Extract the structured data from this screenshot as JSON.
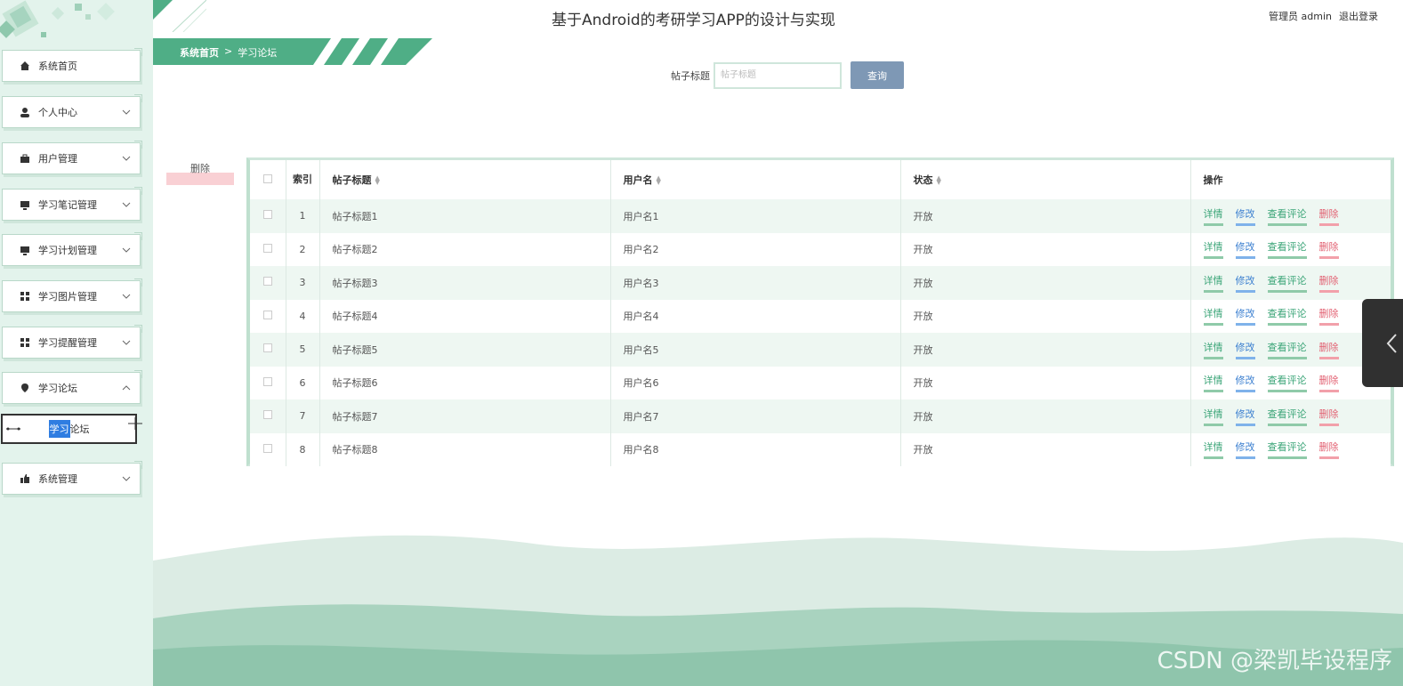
{
  "app": {
    "title": "基于Android的考研学习APP的设计与实现",
    "user_label": "管理员 admin",
    "logout_label": "退出登录"
  },
  "breadcrumb": {
    "home": "系统首页",
    "separator": ">",
    "current": "学习论坛"
  },
  "sidebar": {
    "items": [
      {
        "label": "系统首页",
        "icon": "home-icon",
        "expandable": false
      },
      {
        "label": "个人中心",
        "icon": "user-icon",
        "expandable": true
      },
      {
        "label": "用户管理",
        "icon": "briefcase-icon",
        "expandable": true
      },
      {
        "label": "学习笔记管理",
        "icon": "monitor-icon",
        "expandable": true
      },
      {
        "label": "学习计划管理",
        "icon": "monitor-icon",
        "expandable": true
      },
      {
        "label": "学习图片管理",
        "icon": "grid-icon",
        "expandable": true
      },
      {
        "label": "学习提醒管理",
        "icon": "grid-icon",
        "expandable": true
      },
      {
        "label": "学习论坛",
        "icon": "location-pin-icon",
        "expandable": true,
        "expanded": true
      },
      {
        "label": "系统管理",
        "icon": "thumbs-up-icon",
        "expandable": true
      }
    ],
    "subitem": {
      "selected_part": "学习",
      "rest_part": "论坛"
    }
  },
  "search": {
    "label": "帖子标题",
    "placeholder": "帖子标题",
    "button": "查询"
  },
  "batch_delete_label": "删除",
  "table": {
    "headers": {
      "index": "索引",
      "title": "帖子标题",
      "username": "用户名",
      "status": "状态",
      "actions": "操作"
    },
    "action_labels": {
      "detail": "详情",
      "edit": "修改",
      "comments": "查看评论",
      "delete": "删除"
    },
    "rows": [
      {
        "index": "1",
        "title": "帖子标题1",
        "username": "用户名1",
        "status": "开放"
      },
      {
        "index": "2",
        "title": "帖子标题2",
        "username": "用户名2",
        "status": "开放"
      },
      {
        "index": "3",
        "title": "帖子标题3",
        "username": "用户名3",
        "status": "开放"
      },
      {
        "index": "4",
        "title": "帖子标题4",
        "username": "用户名4",
        "status": "开放"
      },
      {
        "index": "5",
        "title": "帖子标题5",
        "username": "用户名5",
        "status": "开放"
      },
      {
        "index": "6",
        "title": "帖子标题6",
        "username": "用户名6",
        "status": "开放"
      },
      {
        "index": "7",
        "title": "帖子标题7",
        "username": "用户名7",
        "status": "开放"
      },
      {
        "index": "8",
        "title": "帖子标题8",
        "username": "用户名8",
        "status": "开放"
      }
    ]
  },
  "watermark": "CSDN @梁凯毕设程序",
  "colors": {
    "accent_green": "#3aa477",
    "sidebar_bg": "#e3f3ec",
    "breadcrumb_bg": "#4fae86",
    "search_button": "#7e98b5",
    "delete_red": "#e26172",
    "edit_blue": "#3b7fd0"
  }
}
